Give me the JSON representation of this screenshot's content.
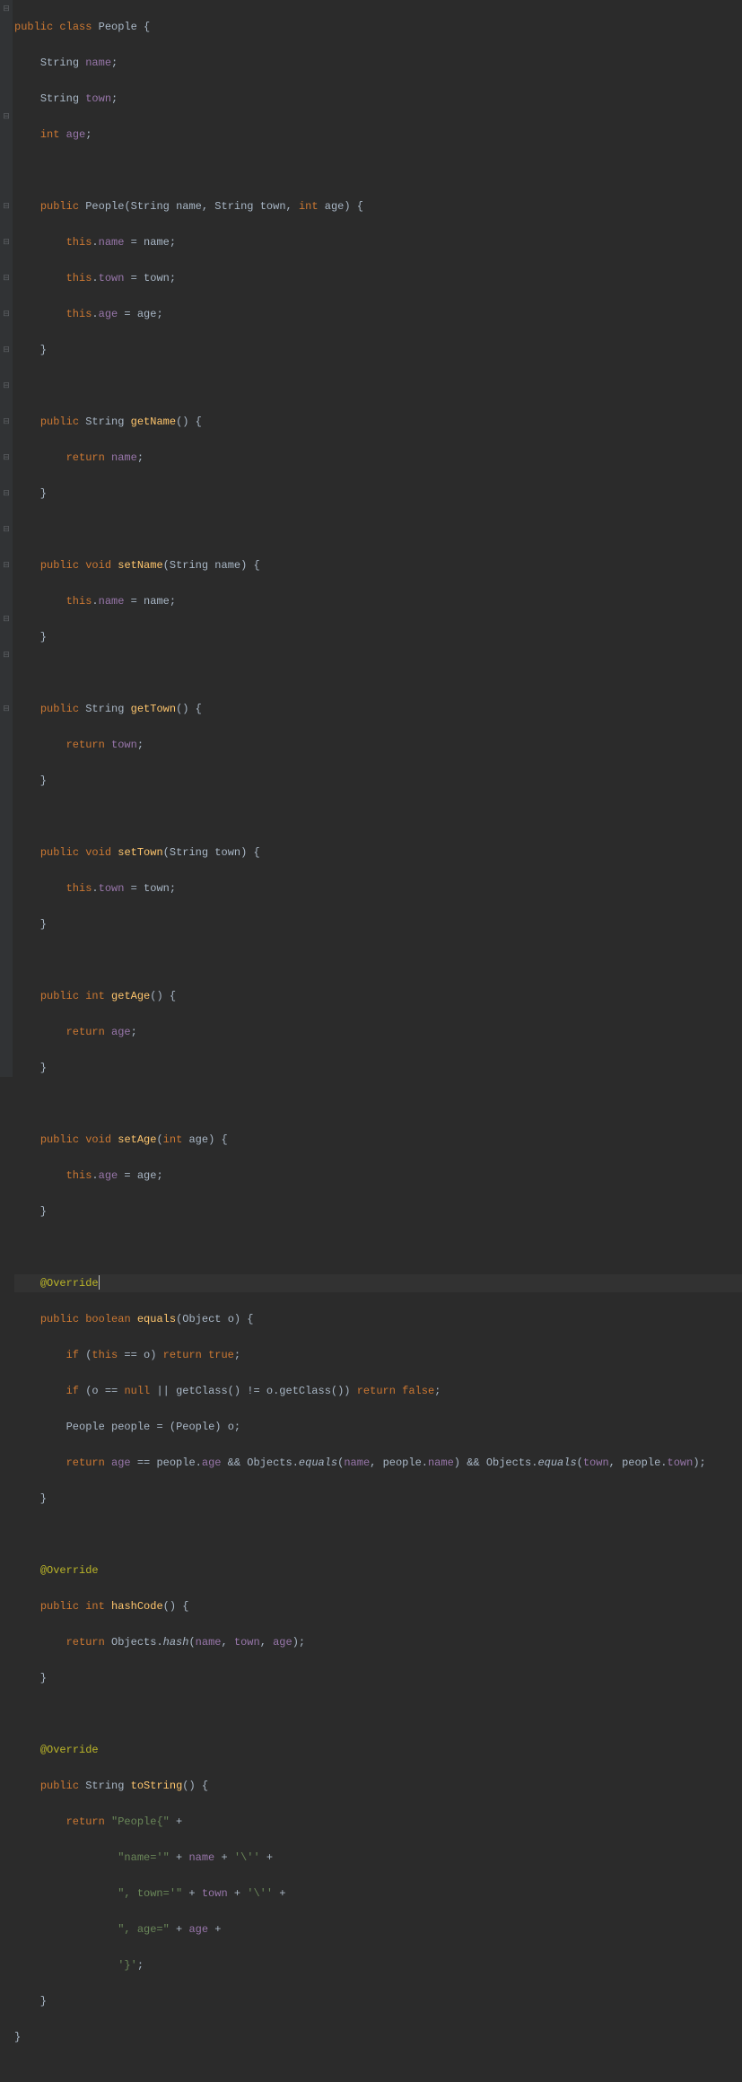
{
  "lang": "java",
  "tokens": {
    "public": "public",
    "class": "class",
    "void": "void",
    "int": "int",
    "this": "this",
    "return": "return",
    "if": "if",
    "true": "true",
    "false": "false",
    "null": "null",
    "boolean": "boolean",
    "Override": "@Override",
    "String": "String",
    "Object": "Object",
    "Objects": "Objects",
    "People": "People"
  },
  "fields": {
    "name": "name",
    "town": "town",
    "age": "age"
  },
  "methods": {
    "getName": "getName",
    "setName": "setName",
    "getTown": "getTown",
    "setTown": "setTown",
    "getAge": "getAge",
    "setAge": "setAge",
    "equals": "equals",
    "hashCode": "hashCode",
    "toString": "toString",
    "getClass": "getClass",
    "hash": "hash"
  },
  "strings": {
    "peopleOpen": "\"People{\"",
    "nameEq": "\"name='\"",
    "townEq": "\", town='\"",
    "ageEq": "\", age=\"",
    "esc": "'\\''",
    "close": "'}'"
  },
  "vars": {
    "o": "o",
    "people": "people"
  }
}
